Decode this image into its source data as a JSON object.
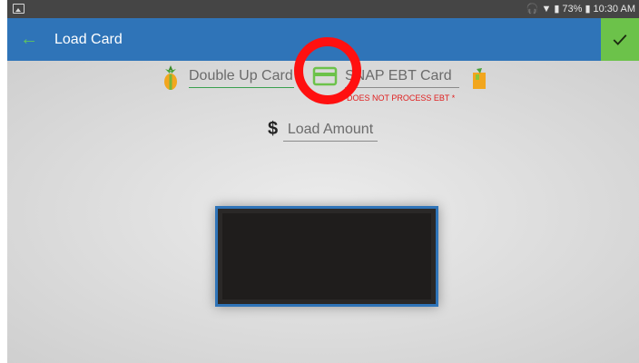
{
  "status_bar": {
    "signal_percent": "73%",
    "time": "10:30 AM"
  },
  "app_bar": {
    "title": "Load Card"
  },
  "form": {
    "double_up_card_placeholder": "Double Up Card",
    "snap_ebt_card_placeholder": "SNAP EBT Card",
    "ebt_warning": "DOES NOT PROCESS EBT *",
    "load_amount_placeholder": "Load Amount",
    "currency_symbol": "$"
  },
  "colors": {
    "app_bar": "#2f74b8",
    "confirm_button": "#6cc24a",
    "warning_text": "#e02020",
    "highlight_ring": "#ff1010"
  }
}
